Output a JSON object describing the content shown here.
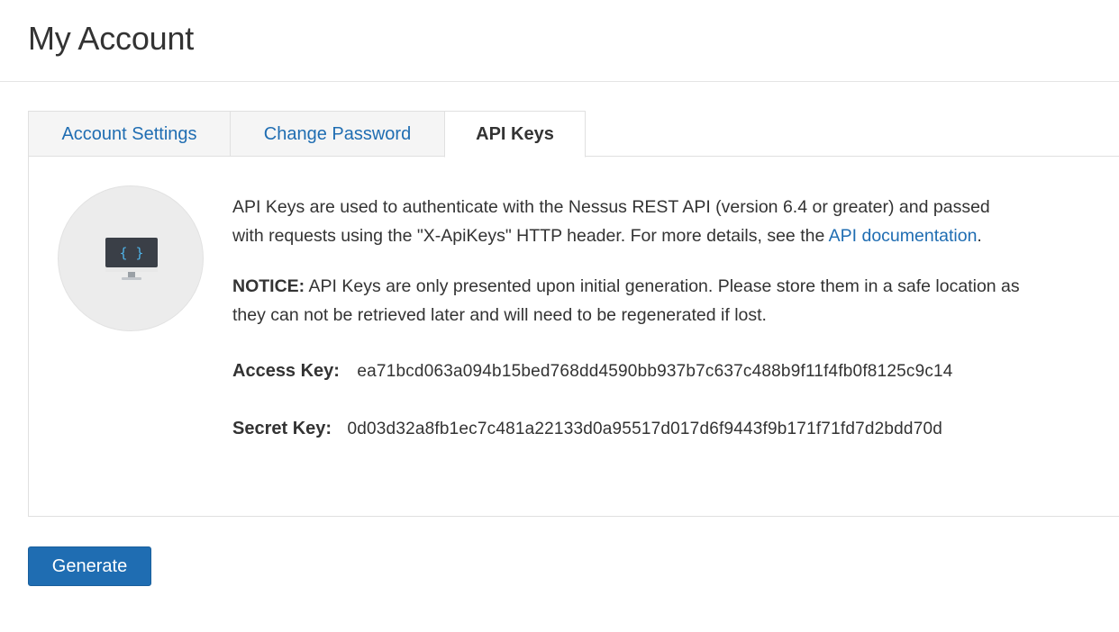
{
  "page": {
    "title": "My Account"
  },
  "tabs": [
    {
      "label": "Account Settings",
      "active": false
    },
    {
      "label": "Change Password",
      "active": false
    },
    {
      "label": "API Keys",
      "active": true
    }
  ],
  "icon": {
    "name": "monitor-code-icon",
    "glyph": "{ }",
    "circle_color": "#ececec",
    "screen_color": "#3a3f47",
    "glyph_color": "#4fb3e8"
  },
  "api_keys": {
    "intro_text": "API Keys are used to authenticate with the Nessus REST API (version 6.4 or greater) and passed with requests using the \"X-ApiKeys\" HTTP header. For more details, see the",
    "doc_link": "API documentation",
    "intro_end": ".",
    "notice_label": "NOTICE:",
    "notice_text": " API Keys are only presented upon initial generation. Please store them in a safe location as they can not be retrieved later and will need to be regenerated if lost.",
    "access_key_label": "Access Key:",
    "access_key_value": "ea71bcd063a094b15bed768dd4590bb937b7c637c488b9f11f4fb0f8125c9c14",
    "secret_key_label": "Secret Key:",
    "secret_key_value": "0d03d32a8fb1ec7c481a22133d0a95517d017d6f9443f9b171f71fd7d2bdd70d"
  },
  "actions": {
    "generate_label": "Generate"
  },
  "colors": {
    "accent": "#1f6db2",
    "text": "#333333",
    "border": "#e0e0e0",
    "tab_inactive_bg": "#f5f5f5"
  }
}
